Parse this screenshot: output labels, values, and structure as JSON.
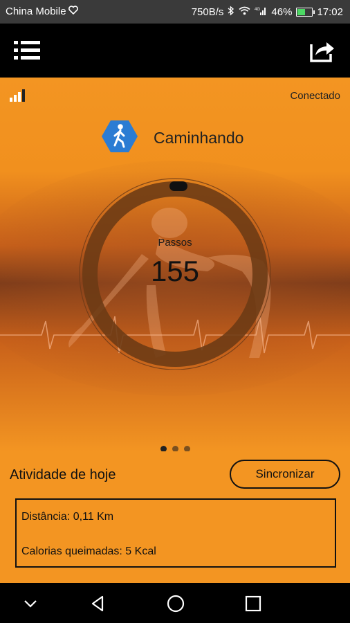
{
  "status_bar": {
    "carrier": "China Mobile",
    "net_speed": "750B/s",
    "battery": "46%",
    "battery_level": 0.46,
    "time": "17:02"
  },
  "toolbar": {
    "menu_icon": "hamburger-menu-icon",
    "share_icon": "share-icon"
  },
  "device": {
    "connection_status": "Conectado",
    "signal_icon": "signal-bars-icon"
  },
  "activity": {
    "icon": "walking-person-icon",
    "label": "Caminhando"
  },
  "steps": {
    "title": "Passos",
    "value": "155"
  },
  "pager": {
    "pages": 3,
    "active_index": 0
  },
  "today": {
    "title": "Atividade de hoje",
    "sync_label": "Sincronizar",
    "distance": "Distância: 0,11 Km",
    "calories": "Calorias queimadas: 5 Kcal"
  },
  "colors": {
    "accent": "#F39522",
    "header": "#000000",
    "hex_icon": "#2B7CD3"
  }
}
